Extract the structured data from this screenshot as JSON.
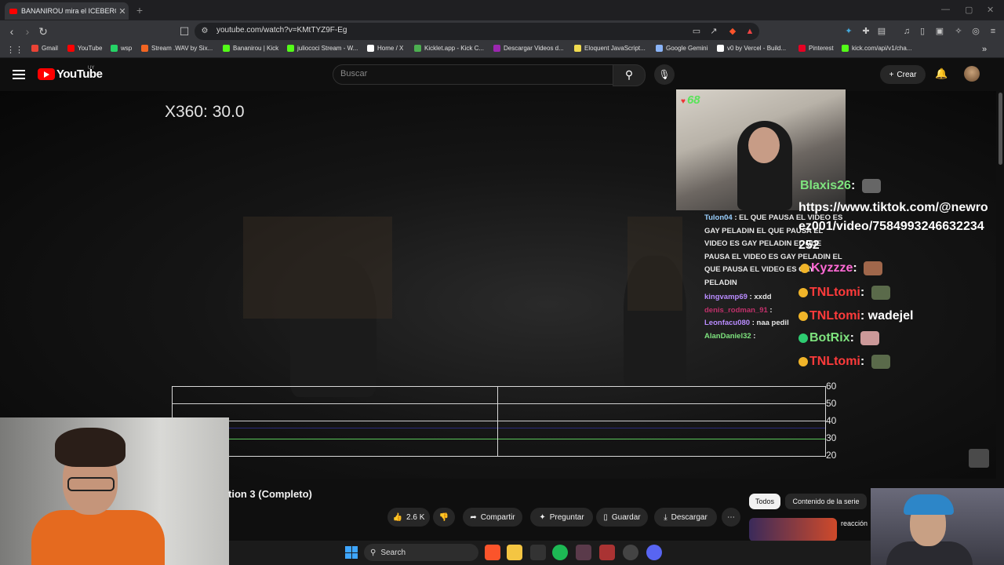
{
  "browser": {
    "tab_title": "BANANIROU mira el ICEBERG",
    "url": "youtube.com/watch?v=KMtTYZ9F-Eg",
    "bookmarks": [
      {
        "label": "Gmail",
        "color": "#ea4335"
      },
      {
        "label": "YouTube",
        "color": "#ff0000"
      },
      {
        "label": "wsp",
        "color": "#25d366"
      },
      {
        "label": "Stream .WAV by Six...",
        "color": "#f26522"
      },
      {
        "label": "Bananirou | Kick",
        "color": "#53fc18"
      },
      {
        "label": "juliococi Stream - W...",
        "color": "#53fc18"
      },
      {
        "label": "Home / X",
        "color": "#ffffff"
      },
      {
        "label": "Kicklet.app - Kick C...",
        "color": "#4caf50"
      },
      {
        "label": "Descargar Videos d...",
        "color": "#9c27b0"
      },
      {
        "label": "Eloquent JavaScript...",
        "color": "#f0db4f"
      },
      {
        "label": "Google Gemini",
        "color": "#8ab4f8"
      },
      {
        "label": "v0 by Vercel - Build...",
        "color": "#ffffff"
      },
      {
        "label": "Pinterest",
        "color": "#e60023"
      },
      {
        "label": "kick.com/api/v1/cha...",
        "color": "#53fc18"
      }
    ]
  },
  "youtube": {
    "logo_text": "YouTube",
    "country": "UY",
    "search_placeholder": "Buscar",
    "create_label": "Crear",
    "video_title": "tion 3 (Completo)",
    "actions": {
      "likes": "2.6 K",
      "share": "Compartir",
      "ask": "Preguntar",
      "save": "Guardar",
      "download": "Descargar",
      "more": "⋯"
    },
    "chips": [
      "Todos",
      "Contenido de la serie"
    ],
    "related_snippet": "reacción"
  },
  "overlay": {
    "fps_readout": "X360: 30.0",
    "viewer_count": "68",
    "graph_labels": [
      "60",
      "50",
      "40",
      "30",
      "20"
    ],
    "chat_small": [
      {
        "user": "Tulon04",
        "text": "EL QUE PAUSA EL VIDEO ES GAY PELADIN EL QUE PAUSA EL VIDEO ES GAY PELADIN EL QUE PAUSA EL VIDEO ES GAY PELADIN EL QUE PAUSA EL VIDEO ES GAY PELADIN",
        "color": "#9ad0ff"
      },
      {
        "user": "kingvamp69",
        "text": "xxdd",
        "color": "#b98cff"
      },
      {
        "user": "denis_rodman_91",
        "text": "",
        "color": "#c0306a"
      },
      {
        "user": "Leonfacu080",
        "text": "naa pedil",
        "color": "#b98cff"
      },
      {
        "user": "AlanDaniel32",
        "text": "",
        "color": "#7ee37e"
      }
    ],
    "chat_big": [
      {
        "user": "Blaxis26",
        "text": "",
        "color": "#7ee37e"
      },
      {
        "user": "",
        "text": "https://www.tiktok.com/@newro",
        "color": "#ffffff"
      },
      {
        "user": "",
        "text": "ez001/video/7584993246632234",
        "color": "#ffffff"
      },
      {
        "user": "",
        "text": "252",
        "color": "#ffffff"
      },
      {
        "user": "Kyzzze",
        "text": "",
        "color": "#ff6ad5"
      },
      {
        "user": "TNLtomi",
        "text": "",
        "color": "#ff3b3b"
      },
      {
        "user": "TNLtomi",
        "text": "wadejel",
        "color": "#ff3b3b"
      },
      {
        "user": "BotRix",
        "text": "",
        "color": "#7ee37e"
      },
      {
        "user": "TNLtomi",
        "text": "",
        "color": "#ff3b3b"
      }
    ]
  },
  "taskbar": {
    "search_label": "Search"
  }
}
